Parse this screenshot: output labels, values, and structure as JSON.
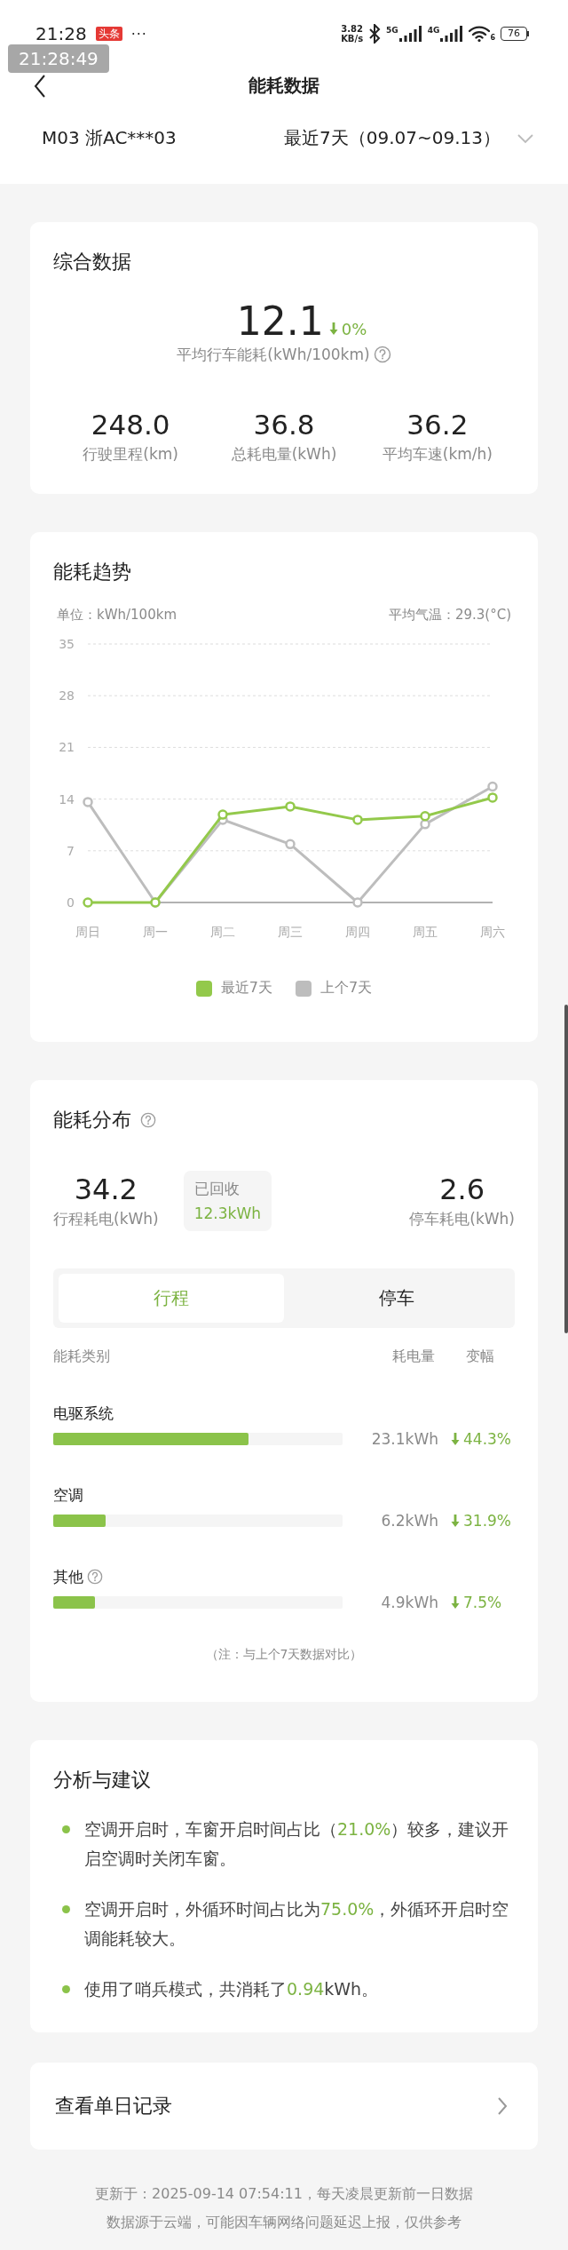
{
  "status_bar": {
    "time": "21:28",
    "app_badge": "头条",
    "more": "···",
    "net_speed": [
      "3.82",
      "KB/s"
    ],
    "networks": [
      "5G",
      "4G"
    ],
    "wifi_label": "6",
    "battery": "76"
  },
  "time_overlay": "21:28:49",
  "header": {
    "title": "能耗数据"
  },
  "selector": {
    "vehicle": "M03 浙AC***03",
    "period": "最近7天（09.07~09.13）"
  },
  "summary": {
    "title": "综合数据",
    "main": {
      "value": "12.1",
      "decrease": true,
      "change": "0%",
      "label": "平均行车能耗(kWh/100km)",
      "help": true
    },
    "stats": [
      {
        "value": "248.0",
        "label": "行驶里程(km)"
      },
      {
        "value": "36.8",
        "label": "总耗电量(kWh)"
      },
      {
        "value": "36.2",
        "label": "平均车速(km/h)"
      }
    ]
  },
  "trend": {
    "title": "能耗趋势",
    "unit": "单位：kWh/100km",
    "temperature": "平均气温：29.3(°C)",
    "chart_data": {
      "type": "line",
      "grid": true,
      "categories": [
        "周日",
        "周一",
        "周二",
        "周三",
        "周四",
        "周五",
        "周六"
      ],
      "ylim": [
        0,
        35
      ],
      "yticks": [
        0,
        7,
        14,
        21,
        28,
        35
      ],
      "series": [
        {
          "name": "最近7天",
          "color": "#93c94b",
          "marker": true,
          "values": [
            0,
            0,
            11.9,
            13.0,
            11.2,
            11.7,
            14.2
          ]
        },
        {
          "name": "上个7天",
          "color": "#bdbdbd",
          "marker": true,
          "values": [
            13.6,
            0,
            11.2,
            7.9,
            0,
            10.6,
            15.7
          ]
        }
      ]
    }
  },
  "distribution": {
    "title": "能耗分布",
    "help": true,
    "trip": {
      "value": "34.2",
      "label": "行程耗电(kWh)"
    },
    "recovered": {
      "label": "已回收",
      "value": "12.3kWh"
    },
    "parking": {
      "value": "2.6",
      "label": "停车耗电(kWh)"
    },
    "tabs": [
      {
        "label": "行程",
        "selected": true
      },
      {
        "label": "停车",
        "selected": false
      }
    ],
    "columns": [
      "能耗类别",
      "耗电量",
      "变幅"
    ],
    "rows": [
      {
        "name": "电驱系统",
        "help": false,
        "level": 0.675,
        "amount": "23.1kWh",
        "decrease": true,
        "change": "44.3%"
      },
      {
        "name": "空调",
        "help": false,
        "level": 0.181,
        "amount": "6.2kWh",
        "decrease": true,
        "change": "31.9%"
      },
      {
        "name": "其他",
        "help": true,
        "level": 0.143,
        "amount": "4.9kWh",
        "decrease": true,
        "change": "7.5%"
      }
    ],
    "note": "（注：与上个7天数据对比）"
  },
  "analysis": {
    "title": "分析与建议",
    "items": [
      {
        "segments": [
          {
            "text": "空调开启时，车窗开启时间占比（",
            "highlight": false
          },
          {
            "text": "21.0%",
            "highlight": true
          },
          {
            "text": "）较多，建议开启空调时关闭车窗。",
            "highlight": false
          }
        ]
      },
      {
        "segments": [
          {
            "text": "空调开启时，外循环时间占比为",
            "highlight": false
          },
          {
            "text": "75.0%",
            "highlight": true
          },
          {
            "text": "，外循环开启时空调能耗较大。",
            "highlight": false
          }
        ]
      },
      {
        "segments": [
          {
            "text": "使用了哨兵模式，共消耗了",
            "highlight": false
          },
          {
            "text": "0.94",
            "highlight": true
          },
          {
            "text": "kWh。",
            "highlight": false
          }
        ]
      }
    ]
  },
  "daily_record": {
    "label": "查看单日记录"
  },
  "footer": [
    "更新于：2025-09-14 07:54:11，每天凌晨更新前一日数据",
    "数据源于云端，可能因车辆网络问题延迟上报，仅供参考"
  ]
}
